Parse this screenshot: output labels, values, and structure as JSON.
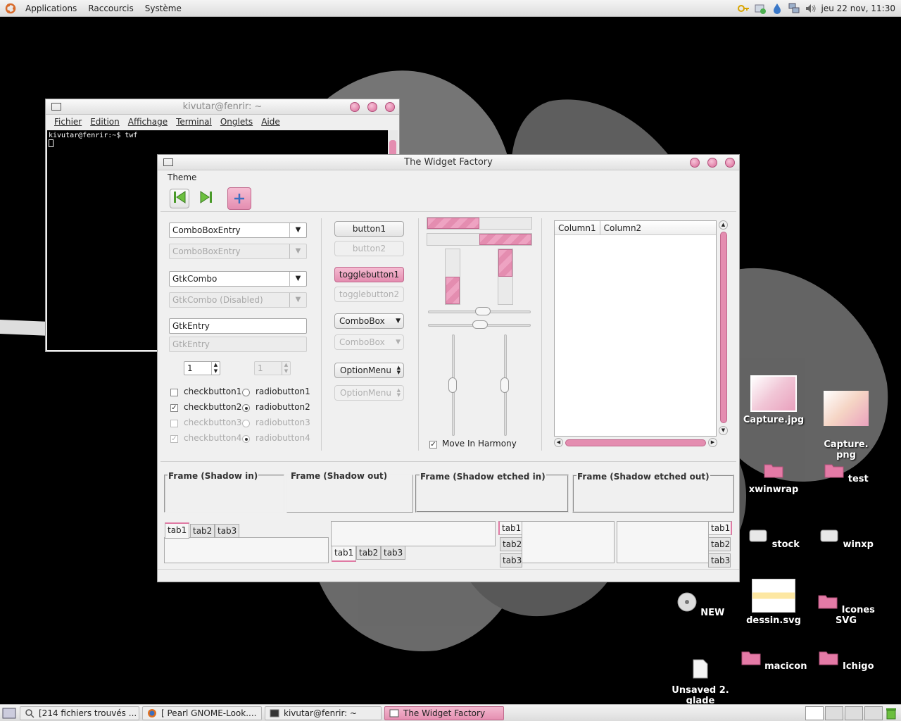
{
  "top_panel": {
    "menus": [
      "Applications",
      "Raccourcis",
      "Système"
    ],
    "clock": "jeu 22 nov, 11:30"
  },
  "terminal": {
    "title": "kivutar@fenrir: ~",
    "menus": [
      "Fichier",
      "Edition",
      "Affichage",
      "Terminal",
      "Onglets",
      "Aide"
    ],
    "line": "kivutar@fenrir:~$ twf"
  },
  "twf": {
    "title": "The Widget Factory",
    "menu": "Theme",
    "combos": {
      "combo_entry": "ComboBoxEntry",
      "combo_entry_dis": "ComboBoxEntry",
      "gtk_combo": "GtkCombo",
      "gtk_combo_dis": "GtkCombo (Disabled)",
      "entry": "GtkEntry",
      "entry_dis": "GtkEntry",
      "spin": "1",
      "spin_dis": "1"
    },
    "checks": [
      "checkbutton1",
      "checkbutton2",
      "checkbutton3",
      "checkbutton4"
    ],
    "radios": [
      "radiobutton1",
      "radiobutton2",
      "radiobutton3",
      "radiobutton4"
    ],
    "buttons": {
      "b1": "button1",
      "b2": "button2",
      "t1": "togglebutton1",
      "t2": "togglebutton2",
      "cb": "ComboBox",
      "cb_dis": "ComboBox",
      "om": "OptionMenu",
      "om_dis": "OptionMenu"
    },
    "progress": {
      "h1": 0.5,
      "h2": 0.5,
      "v1": 0.5,
      "v2": 0.5
    },
    "harmony": "Move In Harmony",
    "tree": {
      "columns": [
        "Column1",
        "Column2"
      ]
    },
    "frames": [
      "Frame (Shadow in)",
      "Frame (Shadow out)",
      "Frame (Shadow etched in)",
      "Frame (Shadow etched out)"
    ],
    "tabs": [
      "tab1",
      "tab2",
      "tab3"
    ]
  },
  "desktop_icons": [
    "Capture.jpg",
    "Capture.\npng",
    "xwinwrap",
    "test",
    "stock",
    "winxp",
    "NEW",
    "dessin.svg",
    "Icones SVG",
    "Unsaved 2.\nglade",
    "macicon",
    "Ichigo"
  ],
  "taskbar": [
    "[214 fichiers trouvés ...",
    "[ Pearl GNOME-Look....",
    "kivutar@fenrir: ~",
    "The Widget Factory"
  ],
  "colors": {
    "accent": "#e48db0",
    "panel": "#e6e6e6"
  }
}
